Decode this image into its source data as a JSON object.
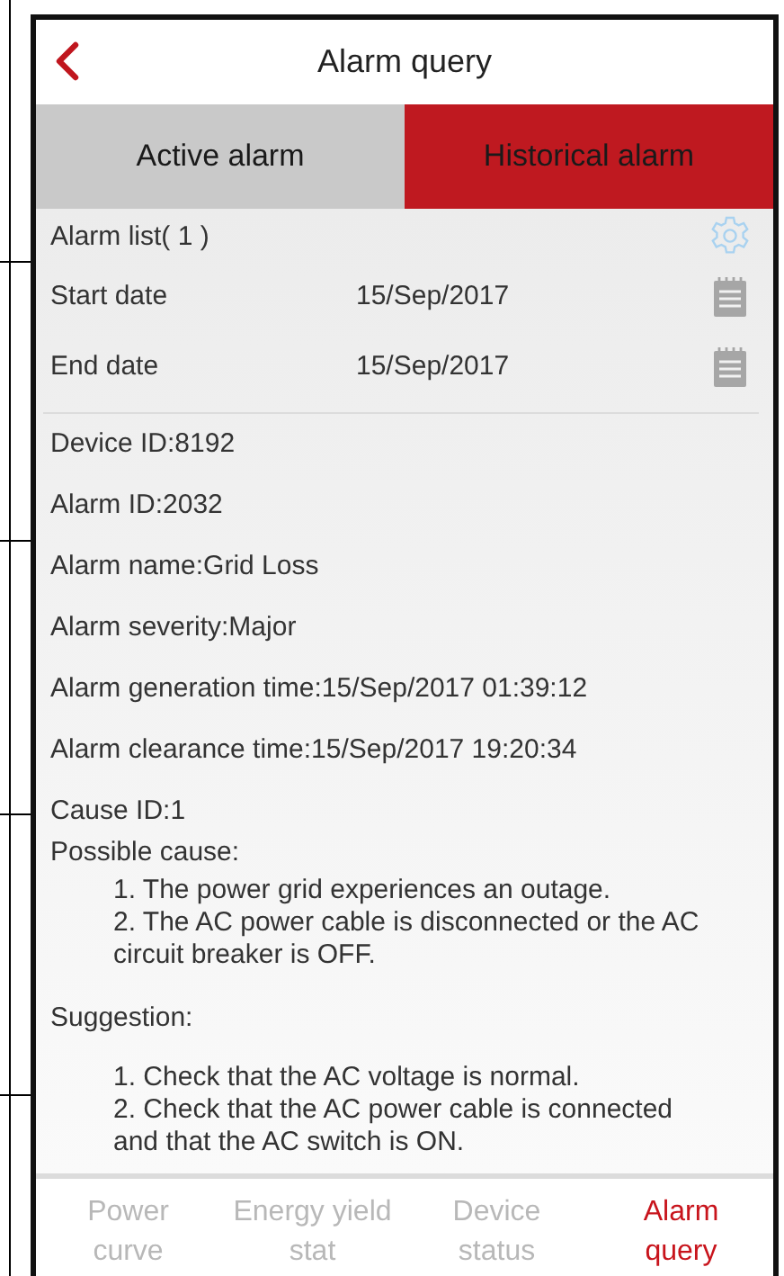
{
  "header": {
    "title": "Alarm query"
  },
  "tabs": [
    {
      "label": "Active alarm",
      "selected": false
    },
    {
      "label": "Historical alarm",
      "selected": true
    }
  ],
  "alarm_list": {
    "label": "Alarm list( 1 )"
  },
  "date_filters": [
    {
      "label": "Start date",
      "value": "15/Sep/2017"
    },
    {
      "label": "End date",
      "value": "15/Sep/2017"
    }
  ],
  "details": [
    "Device ID:8192",
    "Alarm ID:2032",
    "Alarm name:Grid Loss",
    "Alarm severity:Major",
    "Alarm generation time:15/Sep/2017 01:39:12",
    "Alarm clearance time:15/Sep/2017 19:20:34",
    "Cause ID:1"
  ],
  "possible_cause": {
    "heading": "Possible cause:",
    "items": [
      "1. The power grid experiences an outage.",
      "2. The AC power cable is disconnected or the AC circuit breaker is OFF."
    ]
  },
  "suggestion": {
    "heading": "Suggestion:",
    "items": [
      "1. Check that the AC voltage is normal.",
      "2. Check that the AC power cable is connected and that the AC switch is ON."
    ]
  },
  "bottom_nav": [
    {
      "lines": [
        "Power",
        "curve"
      ],
      "selected": false
    },
    {
      "lines": [
        "Energy yield",
        "stat"
      ],
      "selected": false
    },
    {
      "lines": [
        "Device",
        "status"
      ],
      "selected": false
    },
    {
      "lines": [
        "Alarm",
        "query"
      ],
      "selected": true
    }
  ]
}
